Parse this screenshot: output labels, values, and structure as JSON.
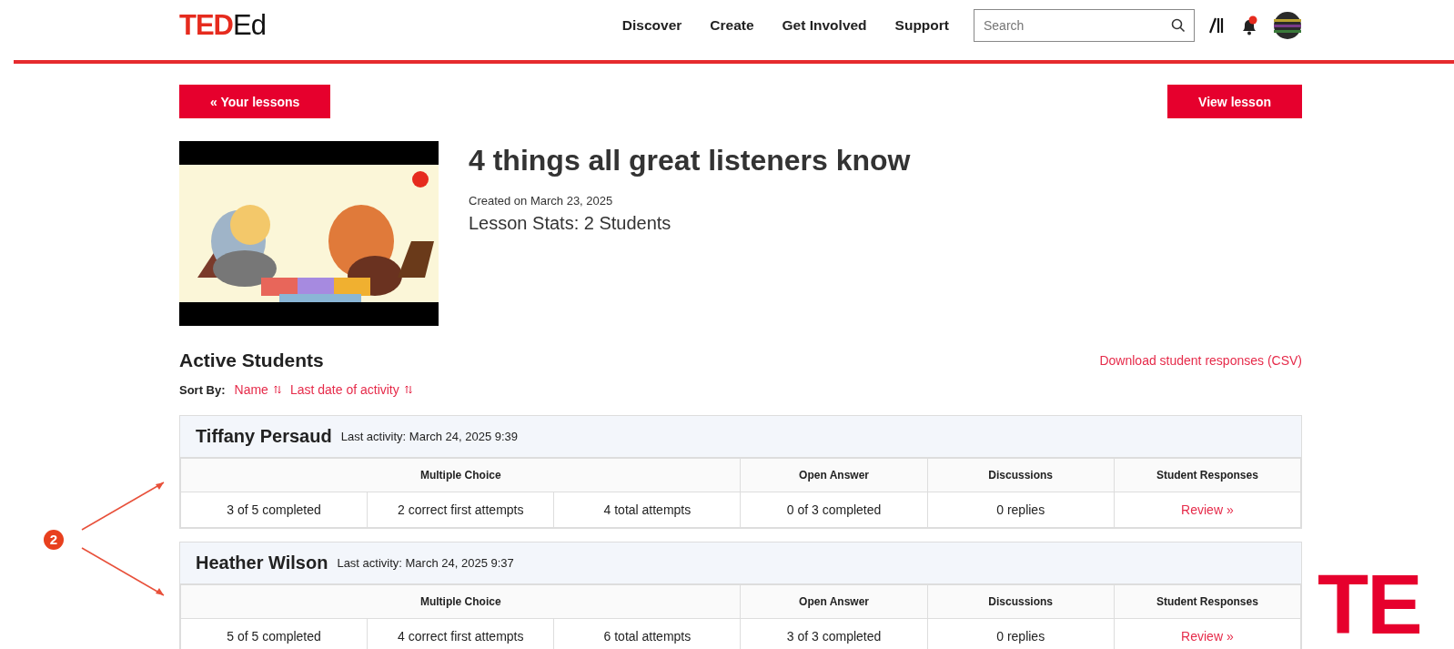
{
  "header": {
    "logo": {
      "bold": "TED",
      "light": "Ed"
    },
    "nav": [
      "Discover",
      "Create",
      "Get Involved",
      "Support"
    ],
    "search": {
      "placeholder": "Search"
    }
  },
  "back_button": "« Your lessons",
  "view_button": "View lesson",
  "lesson": {
    "title": "4 things all great listeners know",
    "created": "Created on March 23, 2025",
    "stats": "Lesson Stats: 2 Students"
  },
  "students_section": {
    "heading": "Active Students",
    "download_link": "Download student responses (CSV)",
    "sort_label": "Sort By:",
    "sort_options": [
      "Name",
      "Last date of activity"
    ]
  },
  "students": [
    {
      "name": "Tiffany Persaud",
      "last_activity": "Last activity: March 24, 2025 9:39",
      "groups": [
        "Multiple Choice",
        "Open Answer",
        "Discussions",
        "Student Responses"
      ],
      "cells": [
        "3 of 5 completed",
        "2 correct first attempts",
        "4 total attempts",
        "0 of 3 completed",
        "0 replies"
      ],
      "review": "Review »"
    },
    {
      "name": "Heather Wilson",
      "last_activity": "Last activity: March 24, 2025 9:37",
      "groups": [
        "Multiple Choice",
        "Open Answer",
        "Discussions",
        "Student Responses"
      ],
      "cells": [
        "5 of 5 completed",
        "4 correct first attempts",
        "6 total attempts",
        "3 of 3 completed",
        "0 replies"
      ],
      "review": "Review »"
    }
  ],
  "annotation": {
    "number": "2"
  },
  "corner_logo": "TE"
}
